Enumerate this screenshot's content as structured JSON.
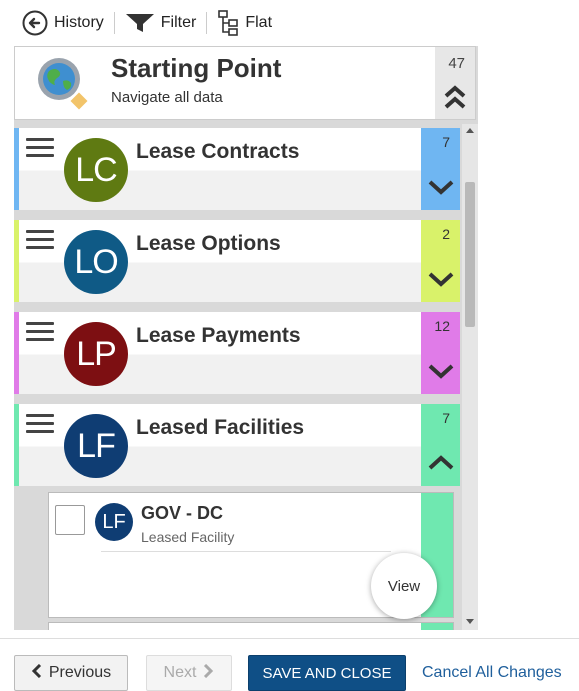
{
  "toolbar": {
    "history_label": "History",
    "filter_label": "Filter",
    "flat_label": "Flat"
  },
  "starting_point": {
    "title": "Starting Point",
    "subtitle": "Navigate all data",
    "count": "47"
  },
  "items": [
    {
      "initials": "LC",
      "title": "Lease Contracts",
      "count": "7",
      "avatar_color": "#5f7a12",
      "accent_color": "#6fb6f2",
      "expanded": false
    },
    {
      "initials": "LO",
      "title": "Lease Options",
      "count": "2",
      "avatar_color": "#0f5a86",
      "accent_color": "#d9f26a",
      "expanded": false
    },
    {
      "initials": "LP",
      "title": "Lease Payments",
      "count": "12",
      "avatar_color": "#7d0f12",
      "accent_color": "#e07be8",
      "expanded": false
    },
    {
      "initials": "LF",
      "title": "Leased Facilities",
      "count": "7",
      "avatar_color": "#0f3d73",
      "accent_color": "#6fe8b0",
      "expanded": true
    }
  ],
  "record": {
    "initials": "LF",
    "title": "GOV - DC",
    "subtitle": "Leased Facility",
    "view_label": "View"
  },
  "footer": {
    "previous_label": "Previous",
    "next_label": "Next",
    "save_label": "SAVE AND CLOSE",
    "cancel_label": "Cancel All Changes"
  },
  "icons": {
    "history": "back-circle-icon",
    "filter": "funnel-icon",
    "flat": "tree-icon",
    "menu": "hamburger-icon",
    "expand": "chevron-down-icon",
    "collapse": "chevron-up-icon",
    "starting": "globe-search-icon"
  }
}
